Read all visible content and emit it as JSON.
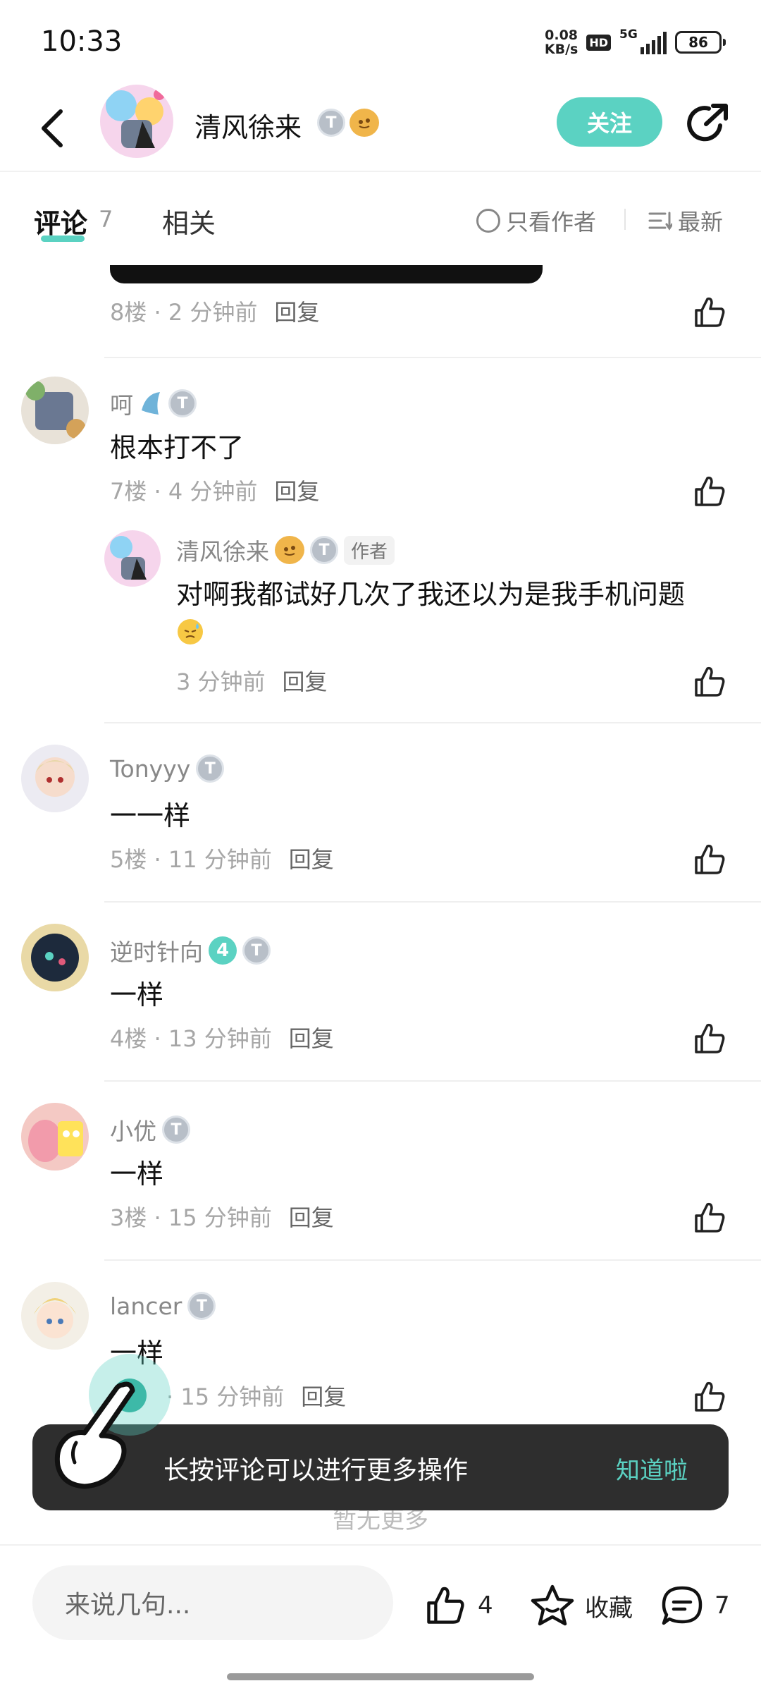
{
  "status_bar": {
    "time": "10:33",
    "net_speed_value": "0.08",
    "net_speed_unit": "KB/s",
    "hd": "HD",
    "network": "5G",
    "battery": "86"
  },
  "header": {
    "user_name": "清风徐来",
    "follow_label": "关注"
  },
  "tabs": {
    "comments_label": "评论",
    "comments_count": "7",
    "related_label": "相关",
    "author_only_label": "只看作者",
    "sort_label": "最新"
  },
  "comments": [
    {
      "meta": "8楼 · 2 分钟前",
      "reply_label": "回复"
    },
    {
      "name": "呵",
      "text": "根本打不了",
      "meta": "7楼 · 4 分钟前",
      "reply_label": "回复",
      "reply": {
        "name": "清风徐来",
        "author_tag": "作者",
        "text": "对啊我都试好几次了我还以为是我手机问题",
        "meta": "3 分钟前",
        "reply_label": "回复"
      }
    },
    {
      "name": "Tonyyy",
      "text": "一一样",
      "meta": "5楼 · 11 分钟前",
      "reply_label": "回复"
    },
    {
      "name": "逆时针向",
      "level": "4",
      "text": "一样",
      "meta": "4楼 · 13 分钟前",
      "reply_label": "回复"
    },
    {
      "name": "小优",
      "text": "一样",
      "meta": "3楼 · 15 分钟前",
      "reply_label": "回复"
    },
    {
      "name": "lancer",
      "text": "一样",
      "meta": "· 15 分钟前",
      "reply_label": "回复"
    }
  ],
  "no_more": "暂无更多",
  "toast": {
    "text": "长按评论可以进行更多操作",
    "ok_label": "知道啦"
  },
  "bottom_bar": {
    "input_placeholder": "来说几句...",
    "like_count": "4",
    "favorite_label": "收藏",
    "comment_count": "7"
  },
  "colors": {
    "accent": "#5bd2c2",
    "toast_bg": "#2e2e2e"
  }
}
